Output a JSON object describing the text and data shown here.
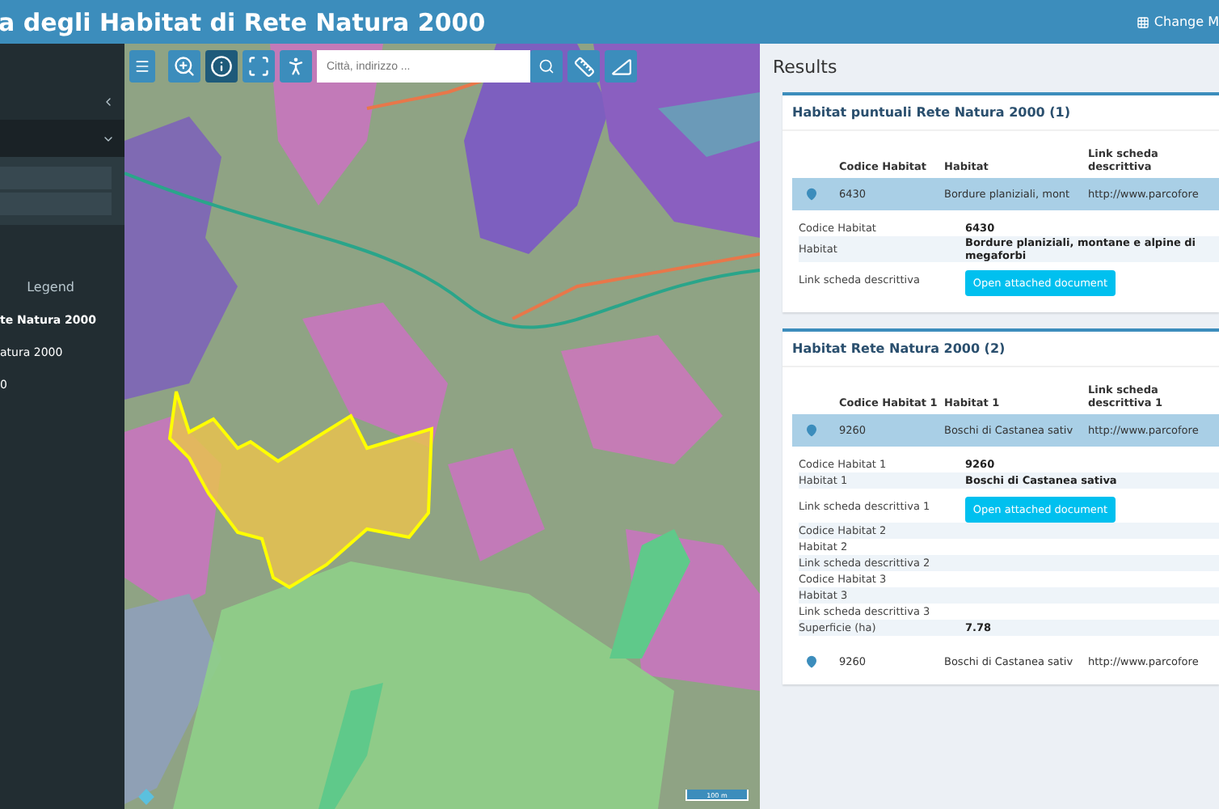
{
  "header": {
    "title": "a degli Habitat di Rete Natura 2000",
    "menu_link": "Change M"
  },
  "sidebar": {
    "items": [
      {
        "kind": "collapse",
        "expanded": false
      },
      {
        "kind": "collapse",
        "expanded": true
      }
    ],
    "legend_title": "Legend",
    "layers": [
      {
        "label": "te Natura 2000",
        "bold": true
      },
      {
        "label": "atura 2000",
        "bold": false
      },
      {
        "label": "0",
        "bold": false
      }
    ]
  },
  "map": {
    "tools": [
      {
        "kind": "zoom",
        "selected": false
      },
      {
        "kind": "info",
        "selected": true
      },
      {
        "kind": "select",
        "selected": false
      },
      {
        "kind": "person",
        "selected": false
      }
    ],
    "search": {
      "placeholder": "Città, indirizzo ..."
    },
    "measure_tools": [
      {
        "kind": "ruler"
      },
      {
        "kind": "area"
      }
    ],
    "scale": "100 m"
  },
  "results": {
    "title": "Results",
    "groups": [
      {
        "title": "Habitat puntuali Rete Natura 2000 (1)",
        "columns": [
          "Codice Habitat",
          "Habitat",
          "Link scheda descrittiva"
        ],
        "rows": [
          {
            "cells": [
              "6430",
              "Bordure planiziali, mont",
              "http://www.parcofore"
            ],
            "selected": true,
            "details": [
              {
                "label": "Codice Habitat",
                "kind": "text",
                "value": "6430"
              },
              {
                "label": "Habitat",
                "kind": "text",
                "value": "Bordure planiziali, montane e alpine di megaforbi"
              },
              {
                "label": "Link scheda descrittiva",
                "kind": "button",
                "value": "Open attached document"
              }
            ]
          }
        ]
      },
      {
        "title": "Habitat Rete Natura 2000 (2)",
        "columns": [
          "Codice Habitat 1",
          "Habitat 1",
          "Link scheda descrittiva 1"
        ],
        "rows": [
          {
            "cells": [
              "9260",
              "Boschi di Castanea sativ",
              "http://www.parcofore"
            ],
            "selected": true,
            "details": [
              {
                "label": "Codice Habitat 1",
                "kind": "text",
                "value": "9260"
              },
              {
                "label": "Habitat 1",
                "kind": "text",
                "value": "Boschi di Castanea sativa"
              },
              {
                "label": "Link scheda descrittiva 1",
                "kind": "button",
                "value": "Open attached document"
              },
              {
                "label": "Codice Habitat 2",
                "kind": "text"
              },
              {
                "label": "Habitat 2",
                "kind": "text"
              },
              {
                "label": "Link scheda descrittiva 2",
                "kind": "text"
              },
              {
                "label": "Codice Habitat 3",
                "kind": "text"
              },
              {
                "label": "Habitat 3",
                "kind": "text"
              },
              {
                "label": "Link scheda descrittiva 3",
                "kind": "text"
              },
              {
                "label": "Superficie (ha)",
                "kind": "text",
                "value": "7.78"
              }
            ]
          },
          {
            "cells": [
              "9260",
              "Boschi di Castanea sativ",
              "http://www.parcofore"
            ],
            "selected": false
          }
        ]
      }
    ]
  }
}
